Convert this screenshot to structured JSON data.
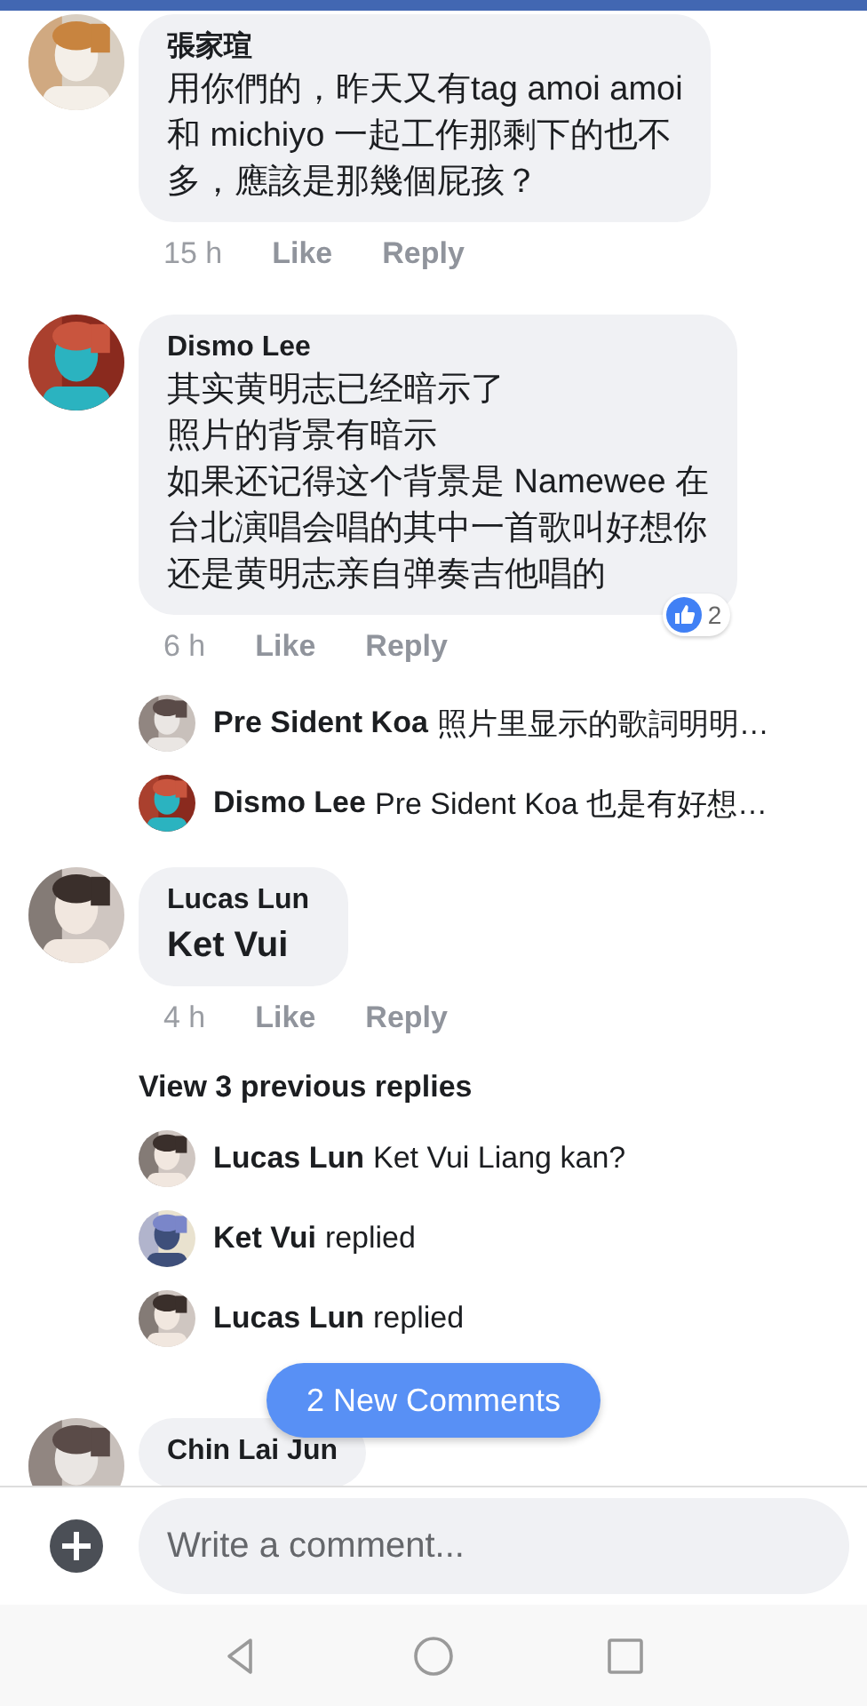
{
  "comments": [
    {
      "kind": "text",
      "author": "張家瑄",
      "lines": [
        "用你們的，昨天又有tag amoi amoi",
        "和 michiyo 一起工作那剩下的也不",
        "多，應該是那幾個屁孩？"
      ],
      "time": "15 h",
      "like": "Like",
      "reply": "Reply"
    },
    {
      "kind": "text",
      "author": "Dismo Lee",
      "lines": [
        "其实黄明志已经暗示了",
        "照片的背景有暗示",
        "如果还记得这个背景是 Namewee 在",
        "台北演唱会唱的其中一首歌叫好想你",
        "还是黄明志亲自弹奏吉他唱的"
      ],
      "time": "6 h",
      "like": "Like",
      "reply": "Reply",
      "reactions": "2",
      "replies": [
        {
          "author": "Pre Sident Koa",
          "text": "照片里显示的歌詞明明…"
        },
        {
          "author": "Dismo Lee",
          "text": "Pre Sident Koa 也是有好想…"
        }
      ]
    },
    {
      "kind": "tag",
      "author": "Lucas Lun",
      "lines": [
        "Ket Vui"
      ],
      "time": "4 h",
      "like": "Like",
      "reply": "Reply",
      "view_previous": "View 3 previous replies",
      "replies": [
        {
          "author": "Lucas Lun",
          "text": "Ket Vui Liang kan?"
        },
        {
          "author": "Ket Vui",
          "text": "replied"
        },
        {
          "author": "Lucas Lun",
          "text": "replied"
        }
      ]
    },
    {
      "kind": "text",
      "author": "Chin Lai Jun"
    }
  ],
  "new_comments_button": "2 New Comments",
  "composer": {
    "placeholder": "Write a comment..."
  }
}
